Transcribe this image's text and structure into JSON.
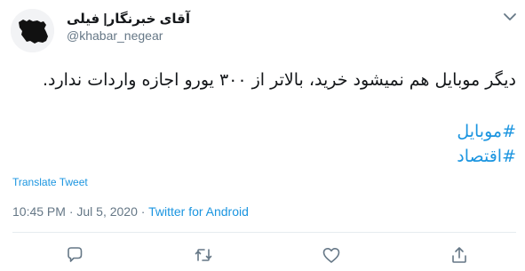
{
  "tweet": {
    "author": {
      "display_name": "آقای خبرنگار| فیلی",
      "handle": "@khabar_negear"
    },
    "text": "دیگر موبایل هم نمیشود خرید، بالاتر از ۳۰۰ یورو اجازه واردات ندارد.",
    "hashtags": [
      "#موبایل",
      "#اقتصاد"
    ],
    "translate_label": "Translate Tweet",
    "timestamp": "10:45 PM · Jul 5, 2020",
    "separator": " · ",
    "source": "Twitter for Android"
  },
  "colors": {
    "link": "#1b95e0",
    "secondary_text": "#657786",
    "divider": "#e6ecf0"
  },
  "icons": {
    "caret": "chevron-down-icon",
    "avatar": "iran-map-silhouette",
    "actions": [
      "reply-icon",
      "retweet-icon",
      "like-icon",
      "share-icon"
    ]
  }
}
